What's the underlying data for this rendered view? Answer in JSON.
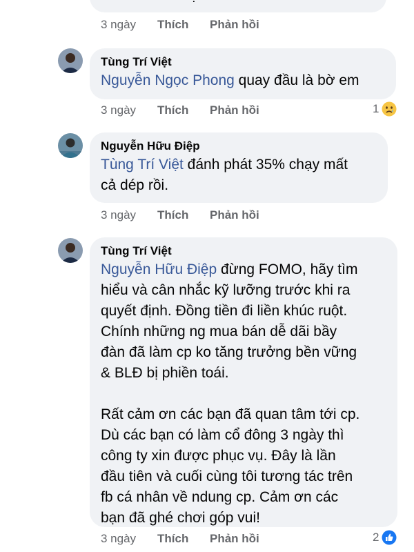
{
  "comments": [
    {
      "partial_text": "em về bờ với ạ",
      "time": "3 ngày",
      "like": "Thích",
      "reply": "Phản hồi"
    },
    {
      "author": "Tùng Trí Việt",
      "mention": "Nguyễn Ngọc Phong",
      "text": " quay đầu là bờ em",
      "time": "3 ngày",
      "like": "Thích",
      "reply": "Phản hồi",
      "reaction_count": "1",
      "reaction_icon": "sad-emoji-icon"
    },
    {
      "author": "Nguyễn Hữu Điệp",
      "mention": "Tùng Trí Việt",
      "text": " đánh phát 35% chạy mất\ncả dép rồi.",
      "time": "3 ngày",
      "like": "Thích",
      "reply": "Phản hồi"
    },
    {
      "author": "Tùng Trí Việt",
      "mention": "Nguyễn Hữu Điệp",
      "text": " đừng FOMO, hãy tìm\nhiểu và cân nhắc kỹ lưỡng trước khi ra\nquyết định. Đồng tiền đi liền khúc ruột.\nChính những ng mua bán dễ dãi bầy\nđàn đã làm cp ko tăng trưởng bền vững\n& BLĐ bị phiền toái.\n\nRất cảm ơn các bạn đã quan tâm tới cp.\nDù các bạn có làm cổ đông 3 ngày thì\ncông ty xin được phục vụ. Đây là lần\nđầu tiên và cuối cùng tôi tương tác trên\nfb cá nhân về ndung cp. Cảm ơn các\nbạn đã ghé chơi góp vui!",
      "time": "3 ngày",
      "like": "Thích",
      "reply": "Phản hồi",
      "reaction_count": "2",
      "reaction_icon": "like-reaction-icon"
    }
  ],
  "colors": {
    "mention": "#385898",
    "bubble": "#f0f2f5",
    "meta": "#65676b",
    "like_blue": "#1877f2"
  }
}
